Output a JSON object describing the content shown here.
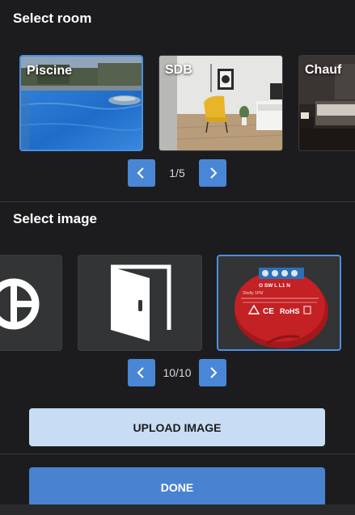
{
  "select_room": {
    "title": "Select room",
    "rooms": [
      {
        "label": "Piscine",
        "selected": true
      },
      {
        "label": "SDB",
        "selected": false
      },
      {
        "label": "Chauf",
        "selected": false
      }
    ],
    "pager": {
      "counter": "1/5"
    }
  },
  "select_image": {
    "title": "Select image",
    "images": [
      {
        "icon": "clock-icon",
        "selected": false
      },
      {
        "icon": "door-open-icon",
        "selected": false
      },
      {
        "icon": "shelly-relay-photo",
        "selected": true
      }
    ],
    "pager": {
      "counter": "10/10"
    }
  },
  "device_photo": {
    "terminals": "O SW L L1 N",
    "model": "Shelly 1PM",
    "rohs": "RoHS",
    "ce": "CE"
  },
  "actions": {
    "upload_label": "UPLOAD IMAGE",
    "done_label": "DONE"
  },
  "colors": {
    "accent": "#4a86d6",
    "upload_bg": "#c8ddf3",
    "background": "#1c1c1e"
  }
}
